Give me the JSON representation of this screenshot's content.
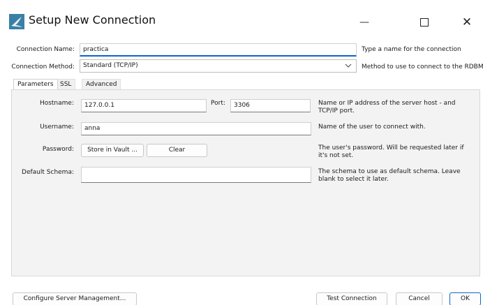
{
  "window": {
    "title": "Setup New Connection",
    "minimize_glyph": "—",
    "close_glyph": "✕"
  },
  "connection_name": {
    "label": "Connection Name:",
    "value": "practica",
    "help": "Type a name for the connection"
  },
  "connection_method": {
    "label": "Connection Method:",
    "value": "Standard (TCP/IP)",
    "help": "Method to use to connect to the RDBMS"
  },
  "tabs": [
    {
      "label": "Parameters"
    },
    {
      "label": "SSL"
    },
    {
      "label": "Advanced"
    }
  ],
  "parameters": {
    "hostname": {
      "label": "Hostname:",
      "value": "127.0.0.1"
    },
    "port": {
      "label": "Port:",
      "value": "3306"
    },
    "hostname_help": "Name or IP address of the server host - and TCP/IP port.",
    "username": {
      "label": "Username:",
      "value": "anna",
      "help": "Name of the user to connect with."
    },
    "password": {
      "label": "Password:",
      "store_label": "Store in Vault ...",
      "clear_label": "Clear",
      "help": "The user's password. Will be requested later if it's not set."
    },
    "default_schema": {
      "label": "Default Schema:",
      "value": "",
      "help": "The schema to use as default schema. Leave blank to select it later."
    }
  },
  "footer": {
    "configure_label": "Configure Server Management...",
    "test_label": "Test Connection",
    "cancel_label": "Cancel",
    "ok_label": "OK"
  },
  "colors": {
    "accent": "#0a67c6",
    "app_icon": "#3a7fa6"
  },
  "icons": {
    "app": "mysql-workbench-dolphin-icon",
    "dropdown": "chevron-down-icon",
    "minimize": "minimize-icon",
    "maximize": "maximize-icon",
    "close": "close-icon"
  }
}
